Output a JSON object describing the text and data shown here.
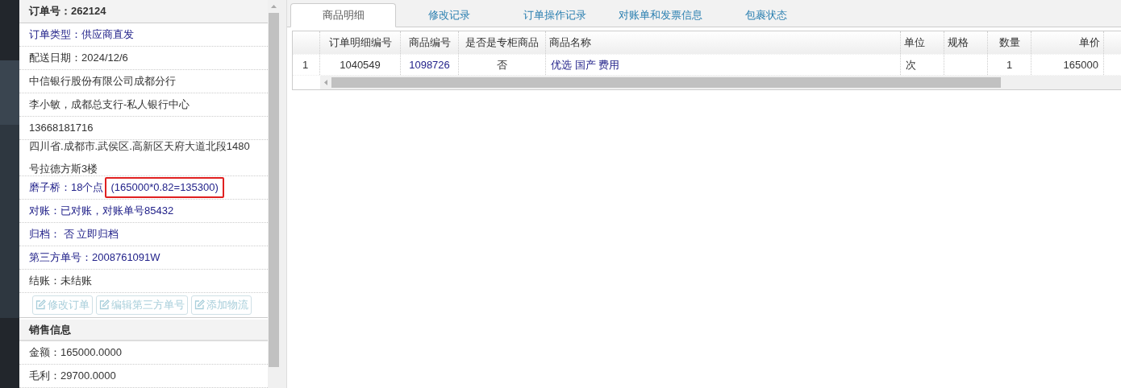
{
  "order_panel": {
    "title": "订单号：262124",
    "rows": [
      {
        "kind": "link",
        "text": "订单类型：供应商直发"
      },
      {
        "kind": "plain",
        "text": "配送日期：2024/12/6"
      },
      {
        "kind": "plain",
        "text": "中信银行股份有限公司成都分行"
      },
      {
        "kind": "plain",
        "text": "李小敏，成都总支行-私人银行中心"
      },
      {
        "kind": "plain",
        "text": "13668181716"
      },
      {
        "kind": "plain",
        "text": "四川省.成都市.武侯区.高新区天府大道北段1480号拉德方斯3楼"
      },
      {
        "kind": "link",
        "text": "磨子桥：18个点",
        "note": "(165000*0.82=135300)"
      },
      {
        "kind": "link",
        "text": "对账：已对账，对账单号85432"
      },
      {
        "kind": "link",
        "text": "归档：  否 立即归档"
      },
      {
        "kind": "link",
        "text": "第三方单号：2008761091W"
      },
      {
        "kind": "plain",
        "text": "结账：未结账"
      }
    ],
    "buttons": [
      {
        "label": "修改订单",
        "disabled": true
      },
      {
        "label": "编辑第三方单号",
        "disabled": true
      },
      {
        "label": "添加物流",
        "disabled": true
      }
    ],
    "section": {
      "title": "销售信息",
      "rows": [
        {
          "text": "金额：165000.0000"
        },
        {
          "text": "毛利：29700.0000"
        }
      ]
    }
  },
  "tabs": [
    {
      "label": "商品明细",
      "selected": true
    },
    {
      "label": "修改记录",
      "selected": false
    },
    {
      "label": "订单操作记录",
      "selected": false
    },
    {
      "label": "对账单和发票信息",
      "selected": false
    },
    {
      "label": "包裹状态",
      "selected": false
    }
  ],
  "table": {
    "columns": [
      "订单明细编号",
      "商品编号",
      "是否是专柜商品",
      "商品名称",
      "单位",
      "规格",
      "数量",
      "单价"
    ],
    "rows": [
      {
        "number": "1",
        "cells": [
          "1040549",
          "1098726",
          "否",
          "优选 国产 费用",
          "次",
          "",
          "1",
          "165000"
        ]
      }
    ]
  }
}
